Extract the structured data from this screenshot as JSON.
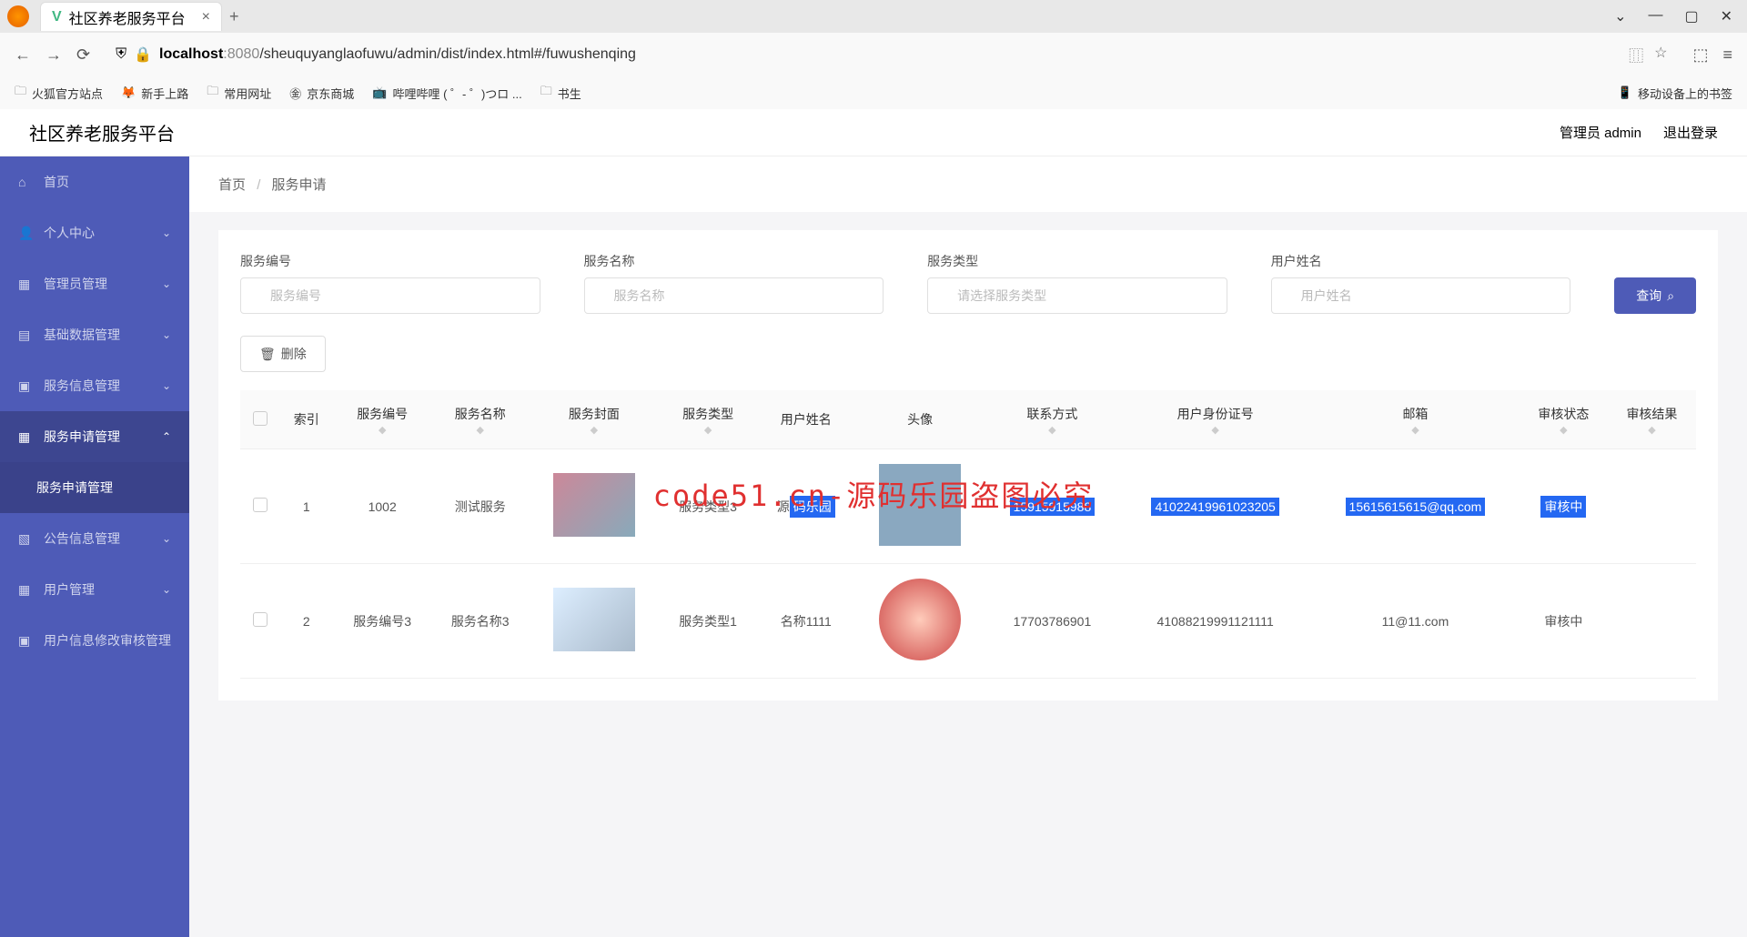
{
  "browser": {
    "tab_title": "社区养老服务平台",
    "url_host": "localhost",
    "url_port": ":8080",
    "url_path": "/sheuquyanglaofuwu/admin/dist/index.html#/fuwushenqing",
    "bookmarks": [
      "火狐官方站点",
      "新手上路",
      "常用网址",
      "京东商城",
      "哔哩哔哩 ( ゜- ゜)つロ ...",
      "书生"
    ],
    "mobile_bookmark": "移动设备上的书签"
  },
  "app": {
    "title": "社区养老服务平台",
    "user_label": "管理员 admin",
    "logout": "退出登录"
  },
  "sidebar": {
    "items": [
      {
        "icon": "⌂",
        "label": "首页"
      },
      {
        "icon": "👤",
        "label": "个人中心",
        "chevron": "⌄"
      },
      {
        "icon": "▦",
        "label": "管理员管理",
        "chevron": "⌄"
      },
      {
        "icon": "▤",
        "label": "基础数据管理",
        "chevron": "⌄"
      },
      {
        "icon": "▣",
        "label": "服务信息管理",
        "chevron": "⌄"
      },
      {
        "icon": "▦",
        "label": "服务申请管理",
        "chevron": "⌃"
      },
      {
        "icon": "",
        "label": "服务申请管理",
        "sub": true
      },
      {
        "icon": "▧",
        "label": "公告信息管理",
        "chevron": "⌄"
      },
      {
        "icon": "▦",
        "label": "用户管理",
        "chevron": "⌄"
      },
      {
        "icon": "▣",
        "label": "用户信息修改审核管理"
      }
    ]
  },
  "breadcrumb": {
    "home": "首页",
    "current": "服务申请"
  },
  "search": {
    "fields": [
      {
        "label": "服务编号",
        "placeholder": "服务编号"
      },
      {
        "label": "服务名称",
        "placeholder": "服务名称"
      },
      {
        "label": "服务类型",
        "placeholder": "请选择服务类型"
      },
      {
        "label": "用户姓名",
        "placeholder": "用户姓名"
      }
    ],
    "query_btn": "查询",
    "delete_btn": "删除"
  },
  "table": {
    "columns": [
      "索引",
      "服务编号",
      "服务名称",
      "服务封面",
      "服务类型",
      "用户姓名",
      "头像",
      "联系方式",
      "用户身份证号",
      "邮箱",
      "审核状态",
      "审核结果"
    ],
    "rows": [
      {
        "index": "1",
        "service_no": "1002",
        "service_name": "测试服务",
        "service_type": "服务类型3",
        "user_name_prefix": "源",
        "user_name_hl": "码乐园",
        "contact": "15915915988",
        "id_no": "41022419961023205",
        "email": "15615615615@qq.com",
        "status": "审核中",
        "highlighted": true
      },
      {
        "index": "2",
        "service_no": "服务编号3",
        "service_name": "服务名称3",
        "service_type": "服务类型1",
        "user_name": "名称1111",
        "contact": "17703786901",
        "id_no": "41088219991121111",
        "email": "11@11.com",
        "status": "审核中",
        "highlighted": false
      }
    ]
  },
  "watermark": "code51.cn-源码乐园盗图必究"
}
